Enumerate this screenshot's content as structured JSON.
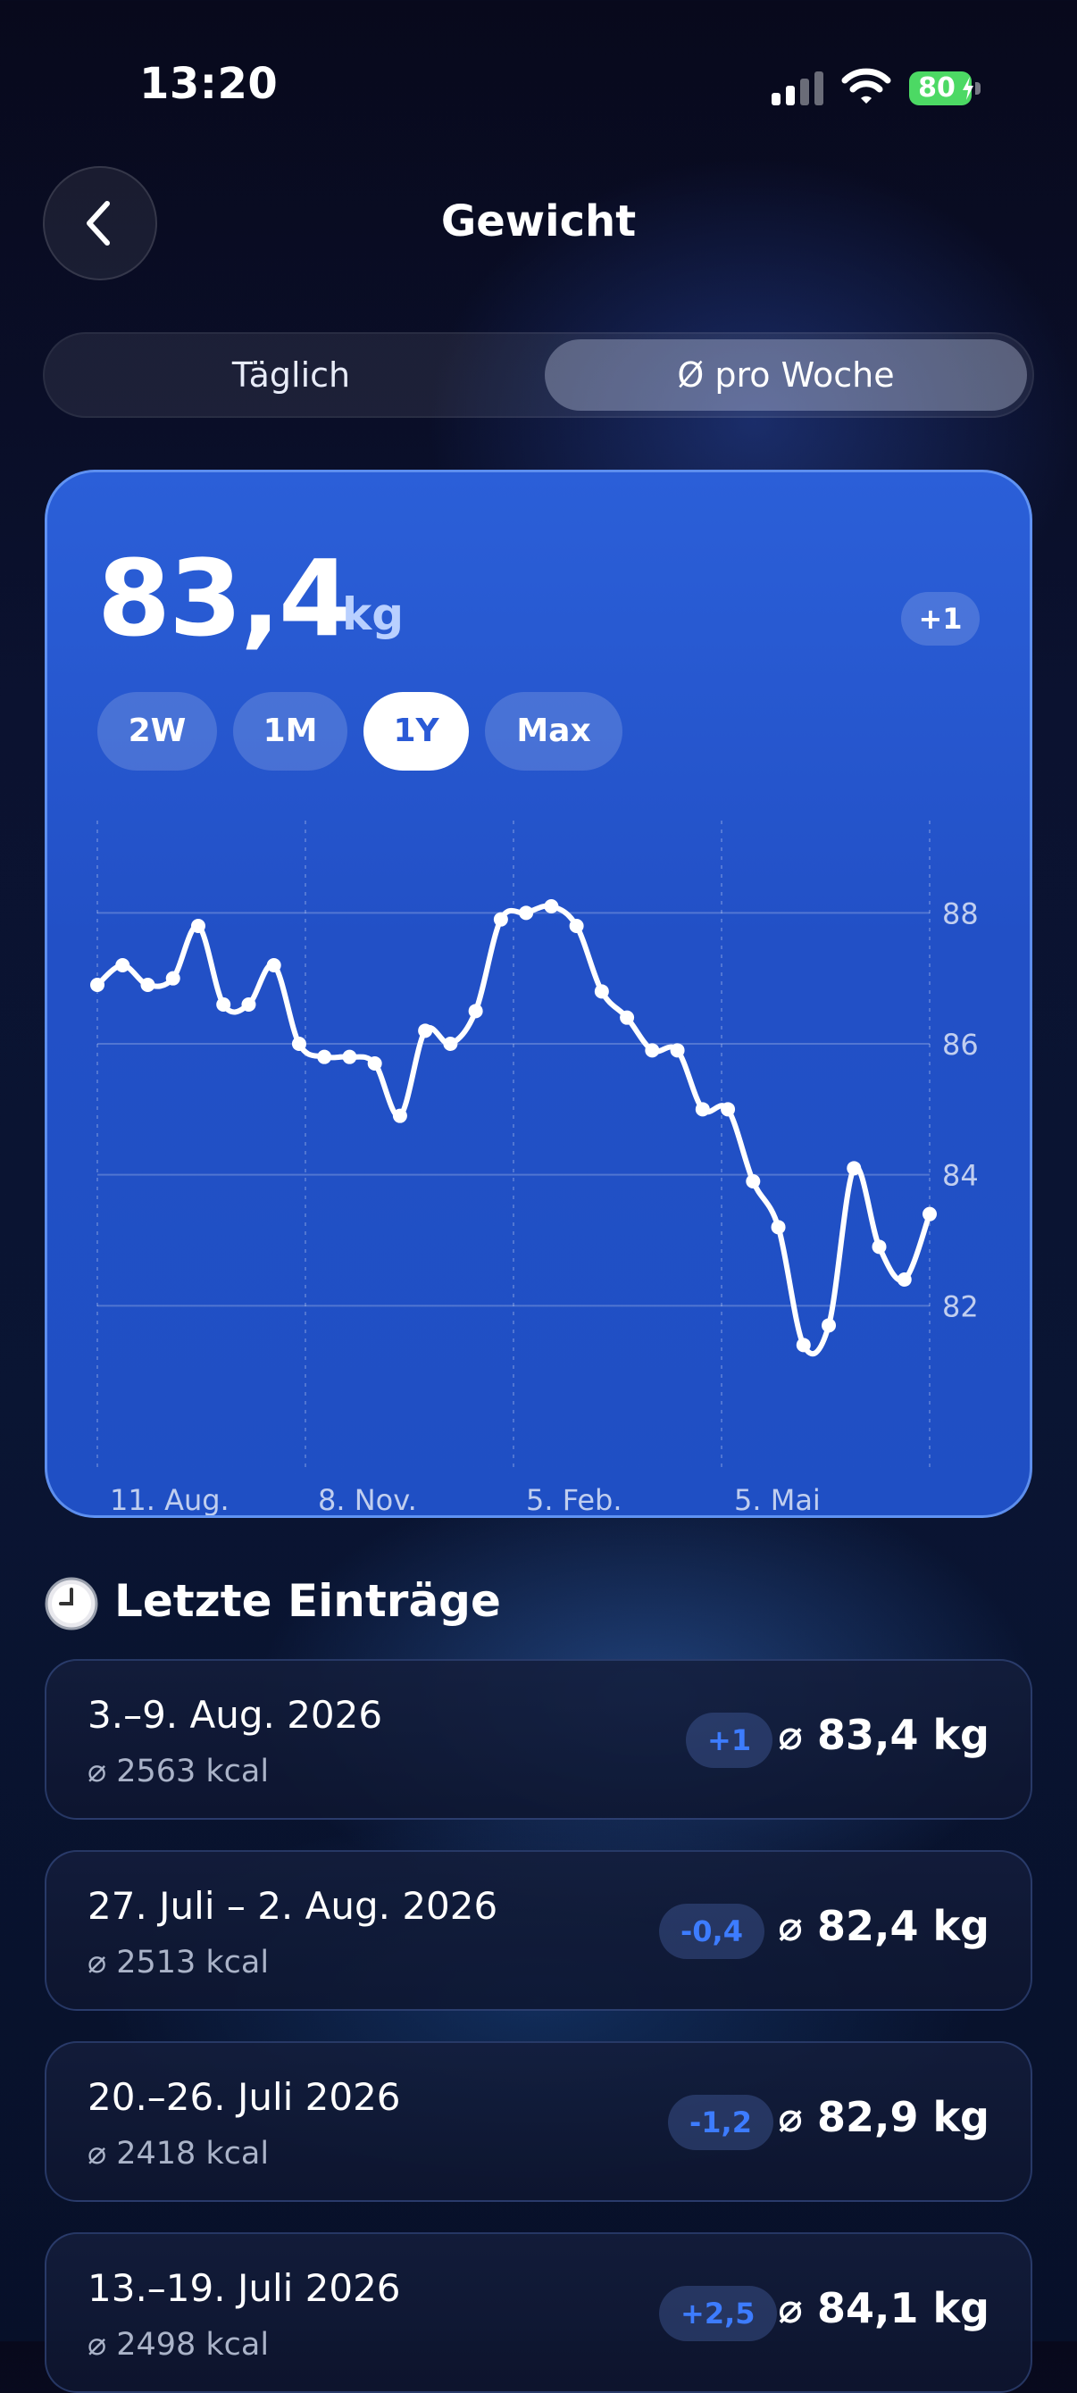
{
  "status_bar": {
    "time": "13:20",
    "battery": "80"
  },
  "header": {
    "title": "Gewicht",
    "back_icon": "chevron-left-icon"
  },
  "tabs": [
    {
      "label": "Täglich",
      "active": false
    },
    {
      "label": "Ø pro Woche",
      "active": true
    }
  ],
  "summary": {
    "value": "83,4",
    "unit": "kg",
    "delta": "+1"
  },
  "ranges": [
    {
      "label": "2W",
      "active": false
    },
    {
      "label": "1M",
      "active": false
    },
    {
      "label": "1Y",
      "active": true
    },
    {
      "label": "Max",
      "active": false
    }
  ],
  "chart_data": {
    "type": "line",
    "title": "",
    "xlabel": "",
    "ylabel": "",
    "ylim": [
      80.3,
      89
    ],
    "y_ticks": [
      88,
      86,
      84,
      82
    ],
    "x_tick_labels": [
      "11. Aug.",
      "8. Nov.",
      "5. Feb.",
      "5. Mai"
    ],
    "grid": true,
    "series": [
      {
        "values": [
          86.9,
          87.2,
          86.9,
          87.0,
          87.8,
          86.6,
          86.6,
          87.2,
          86.0,
          85.8,
          85.8,
          85.7,
          84.9,
          86.2,
          86.0,
          86.5,
          87.9,
          88.0,
          88.1,
          87.8,
          86.8,
          86.4,
          85.9,
          85.9,
          85.0,
          85.0,
          83.9,
          83.2,
          81.4,
          81.7,
          84.1,
          82.9,
          82.4,
          83.4
        ],
        "color": "#ffffff"
      }
    ]
  },
  "recent": {
    "icon": "clock-icon",
    "title": "Letzte Einträge",
    "entries": [
      {
        "range": "3.–9. Aug. 2026",
        "kcal": "⌀ 2563 kcal",
        "delta": "+1",
        "avg": "⌀ 83,4 kg"
      },
      {
        "range": "27. Juli – 2. Aug. 2026",
        "kcal": "⌀ 2513 kcal",
        "delta": "-0,4",
        "avg": "⌀ 82,4 kg"
      },
      {
        "range": "20.–26. Juli 2026",
        "kcal": "⌀ 2418 kcal",
        "delta": "-1,2",
        "avg": "⌀ 82,9 kg"
      },
      {
        "range": "13.–19. Juli 2026",
        "kcal": "⌀ 2498 kcal",
        "delta": "+2,5",
        "avg": "⌀ 84,1 kg"
      }
    ]
  },
  "colors": {
    "accent": "#2a5ad6",
    "delta_text": "#3d7cff",
    "battery": "#4cd964"
  }
}
